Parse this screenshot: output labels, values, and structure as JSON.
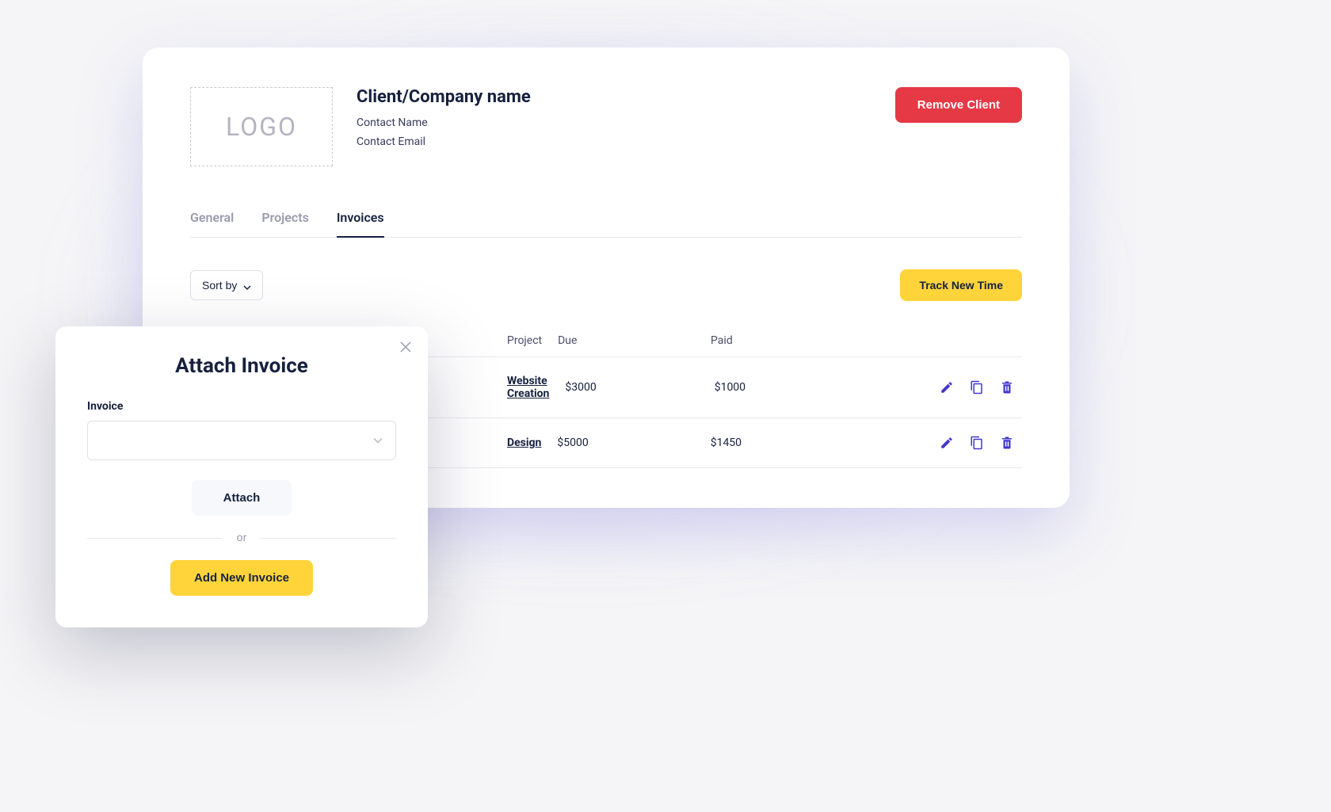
{
  "header": {
    "logo_placeholder": "LOGO",
    "company_name": "Client/Company name",
    "contact_name": "Contact Name",
    "contact_email": "Contact Email",
    "remove_button": "Remove Client"
  },
  "tabs": {
    "general": "General",
    "projects": "Projects",
    "invoices": "Invoices"
  },
  "toolbar": {
    "sort_label": "Sort by",
    "track_button": "Track New Time"
  },
  "table": {
    "headers": {
      "project": "Project",
      "due": "Due",
      "paid": "Paid"
    },
    "rows": [
      {
        "project": "Website Creation",
        "due": "$3000",
        "paid": "$1000"
      },
      {
        "project": "Design",
        "due": "$5000",
        "paid": "$1450"
      }
    ]
  },
  "modal": {
    "title": "Attach Invoice",
    "label": "Invoice",
    "attach_button": "Attach",
    "or_text": "or",
    "add_button": "Add New Invoice"
  }
}
